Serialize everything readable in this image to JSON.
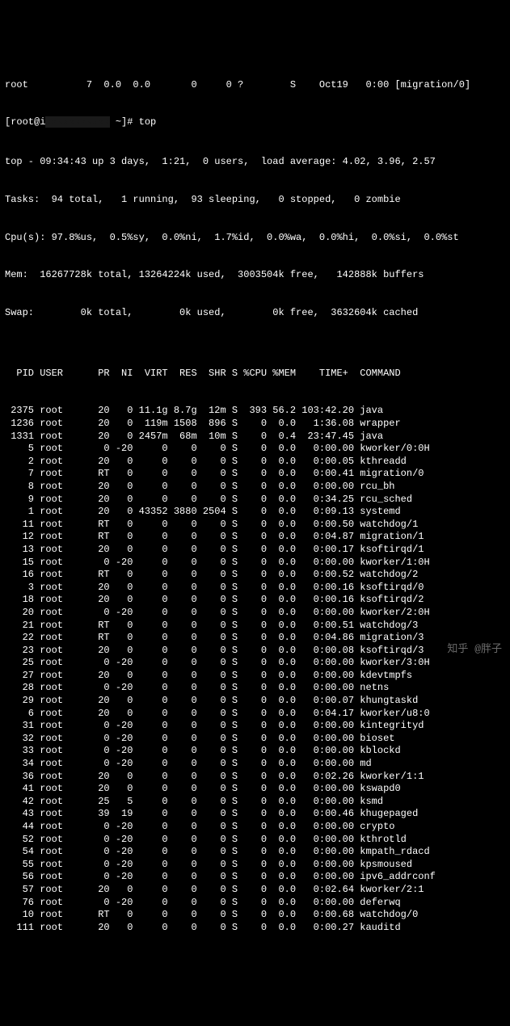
{
  "header": {
    "first_row": "root          7  0.0  0.0       0     0 ?        S    Oct19   0:00 [migration/0]",
    "prompt_prefix": "[root@i",
    "prompt_suffix": " ~]# top",
    "summary_line": "top - 09:34:43 up 3 days,  1:21,  0 users,  load average: 4.02, 3.96, 2.57",
    "tasks_line": "Tasks:  94 total,   1 running,  93 sleeping,   0 stopped,   0 zombie",
    "cpu_line": "Cpu(s): 97.8%us,  0.5%sy,  0.0%ni,  1.7%id,  0.0%wa,  0.0%hi,  0.0%si,  0.0%st",
    "mem_line": "Mem:  16267728k total, 13264224k used,  3003504k free,   142888k buffers",
    "swap_line": "Swap:        0k total,        0k used,        0k free,  3632604k cached"
  },
  "table": {
    "header": "  PID USER      PR  NI  VIRT  RES  SHR S %CPU %MEM    TIME+  COMMAND",
    "rows": [
      " 2375 root      20   0 11.1g 8.7g  12m S  393 56.2 103:42.20 java",
      " 1236 root      20   0  119m 1508  896 S    0  0.0   1:36.08 wrapper",
      " 1331 root      20   0 2457m  68m  10m S    0  0.4  23:47.45 java",
      "    5 root       0 -20     0    0    0 S    0  0.0   0:00.00 kworker/0:0H",
      "    2 root      20   0     0    0    0 S    0  0.0   0:00.05 kthreadd",
      "    7 root      RT   0     0    0    0 S    0  0.0   0:00.41 migration/0",
      "    8 root      20   0     0    0    0 S    0  0.0   0:00.00 rcu_bh",
      "    9 root      20   0     0    0    0 S    0  0.0   0:34.25 rcu_sched",
      "    1 root      20   0 43352 3880 2504 S    0  0.0   0:09.13 systemd",
      "   11 root      RT   0     0    0    0 S    0  0.0   0:00.50 watchdog/1",
      "   12 root      RT   0     0    0    0 S    0  0.0   0:04.87 migration/1",
      "   13 root      20   0     0    0    0 S    0  0.0   0:00.17 ksoftirqd/1",
      "   15 root       0 -20     0    0    0 S    0  0.0   0:00.00 kworker/1:0H",
      "   16 root      RT   0     0    0    0 S    0  0.0   0:00.52 watchdog/2",
      "    3 root      20   0     0    0    0 S    0  0.0   0:00.16 ksoftirqd/0",
      "   18 root      20   0     0    0    0 S    0  0.0   0:00.16 ksoftirqd/2",
      "   20 root       0 -20     0    0    0 S    0  0.0   0:00.00 kworker/2:0H",
      "   21 root      RT   0     0    0    0 S    0  0.0   0:00.51 watchdog/3",
      "   22 root      RT   0     0    0    0 S    0  0.0   0:04.86 migration/3",
      "   23 root      20   0     0    0    0 S    0  0.0   0:00.08 ksoftirqd/3",
      "   25 root       0 -20     0    0    0 S    0  0.0   0:00.00 kworker/3:0H",
      "   27 root      20   0     0    0    0 S    0  0.0   0:00.00 kdevtmpfs",
      "   28 root       0 -20     0    0    0 S    0  0.0   0:00.00 netns",
      "   29 root      20   0     0    0    0 S    0  0.0   0:00.07 khungtaskd",
      "    6 root      20   0     0    0    0 S    0  0.0   0:04.17 kworker/u8:0",
      "   31 root       0 -20     0    0    0 S    0  0.0   0:00.00 kintegrityd",
      "   32 root       0 -20     0    0    0 S    0  0.0   0:00.00 bioset",
      "   33 root       0 -20     0    0    0 S    0  0.0   0:00.00 kblockd",
      "   34 root       0 -20     0    0    0 S    0  0.0   0:00.00 md",
      "   36 root      20   0     0    0    0 S    0  0.0   0:02.26 kworker/1:1",
      "   41 root      20   0     0    0    0 S    0  0.0   0:00.00 kswapd0",
      "   42 root      25   5     0    0    0 S    0  0.0   0:00.00 ksmd",
      "   43 root      39  19     0    0    0 S    0  0.0   0:00.46 khugepaged",
      "   44 root       0 -20     0    0    0 S    0  0.0   0:00.00 crypto",
      "   52 root       0 -20     0    0    0 S    0  0.0   0:00.00 kthrotld",
      "   54 root       0 -20     0    0    0 S    0  0.0   0:00.00 kmpath_rdacd",
      "   55 root       0 -20     0    0    0 S    0  0.0   0:00.00 kpsmoused",
      "   56 root       0 -20     0    0    0 S    0  0.0   0:00.00 ipv6_addrconf",
      "   57 root      20   0     0    0    0 S    0  0.0   0:02.64 kworker/2:1",
      "   76 root       0 -20     0    0    0 S    0  0.0   0:00.00 deferwq",
      "   10 root      RT   0     0    0    0 S    0  0.0   0:00.68 watchdog/0",
      "  111 root      20   0     0    0    0 S    0  0.0   0:00.27 kauditd"
    ]
  },
  "watermark": "知乎 @胖子"
}
